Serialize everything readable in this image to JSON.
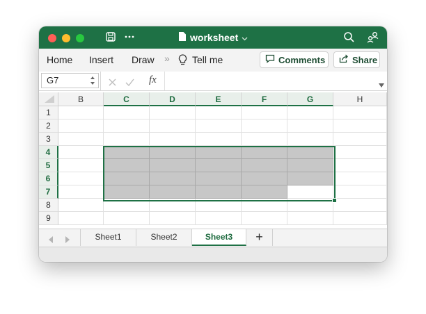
{
  "window": {
    "title": "worksheet"
  },
  "ribbon": {
    "tabs": [
      {
        "label": "Home"
      },
      {
        "label": "Insert"
      },
      {
        "label": "Draw"
      }
    ],
    "overflow": "»",
    "tell_me": "Tell me",
    "comments_label": "Comments",
    "share_label": "Share"
  },
  "formula_bar": {
    "cell_ref": "G7",
    "fx_label": "fx",
    "value": ""
  },
  "grid": {
    "columns": [
      "B",
      "C",
      "D",
      "E",
      "F",
      "G",
      "H"
    ],
    "rows": [
      "1",
      "2",
      "3",
      "4",
      "5",
      "6",
      "7",
      "8",
      "9"
    ],
    "selected_columns": [
      "C",
      "D",
      "E",
      "F",
      "G"
    ],
    "selected_rows": [
      "4",
      "5",
      "6",
      "7"
    ],
    "active_cell": "G7"
  },
  "sheets": {
    "tabs": [
      {
        "label": "Sheet1"
      },
      {
        "label": "Sheet2"
      },
      {
        "label": "Sheet3",
        "active": true
      }
    ],
    "add_label": "+"
  },
  "colors": {
    "accent": "#1e7145",
    "fill": "#c7c7c7"
  }
}
